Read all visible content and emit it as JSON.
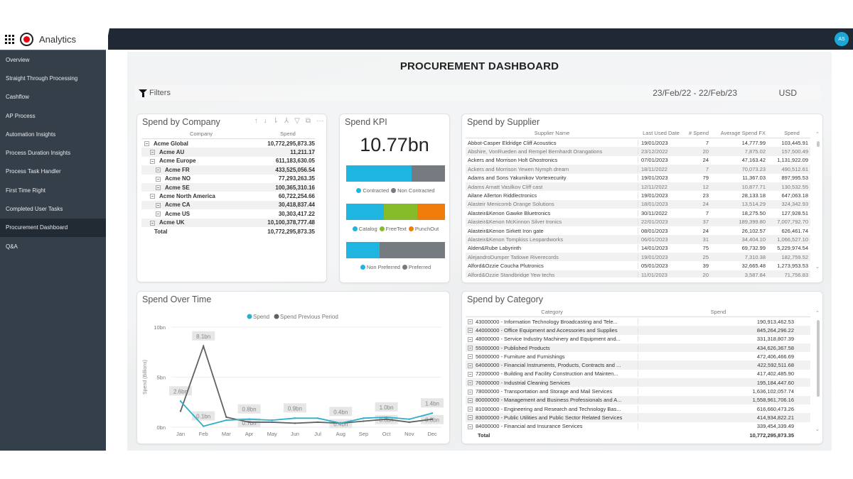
{
  "app": {
    "title": "Analytics",
    "user_initials": "AS",
    "accent_color": "#1aa6d9"
  },
  "sidebar": {
    "items": [
      {
        "label": "Overview",
        "active": false
      },
      {
        "label": "Straight Through Processing",
        "active": false
      },
      {
        "label": "Cashflow",
        "active": false
      },
      {
        "label": "AP Process",
        "active": false
      },
      {
        "label": "Automation Insights",
        "active": false
      },
      {
        "label": "Process Duration Insights",
        "active": false
      },
      {
        "label": "Process Task Handler",
        "active": false
      },
      {
        "label": "First Time Right",
        "active": false
      },
      {
        "label": "Completed User Tasks",
        "active": false
      },
      {
        "label": "Procurement Dashboard",
        "active": true
      },
      {
        "label": "Q&A",
        "active": false
      }
    ]
  },
  "report": {
    "title": "PROCUREMENT DASHBOARD",
    "filters_label": "Filters",
    "date_range": "23/Feb/22 - 22/Feb/23",
    "currency": "USD"
  },
  "spend_by_company": {
    "title": "Spend by Company",
    "columns": [
      "Company",
      "Spend"
    ],
    "header_icons": [
      "sort-ascending-icon",
      "sort-descending-icon",
      "expand-all-icon",
      "drill-hierarchy-icon",
      "filter-icon",
      "focus-mode-icon",
      "more-options-icon"
    ],
    "rows": [
      {
        "name": "Acme Global",
        "level": 0,
        "spend": "10,772,295,873.35"
      },
      {
        "name": "Acme AU",
        "level": 1,
        "spend": "11,211.17"
      },
      {
        "name": "Acme Europe",
        "level": 1,
        "spend": "611,183,630.05"
      },
      {
        "name": "Acme FR",
        "level": 2,
        "spend": "433,525,056.54"
      },
      {
        "name": "Acme NO",
        "level": 2,
        "spend": "77,293,263.35"
      },
      {
        "name": "Acme SE",
        "level": 2,
        "spend": "100,365,310.16"
      },
      {
        "name": "Acme North America",
        "level": 1,
        "spend": "60,722,254.66"
      },
      {
        "name": "Acme CA",
        "level": 2,
        "spend": "30,418,837.44"
      },
      {
        "name": "Acme US",
        "level": 2,
        "spend": "30,303,417.22"
      },
      {
        "name": "Acme UK",
        "level": 1,
        "spend": "10,100,378,777.48"
      }
    ],
    "total_label": "Total",
    "total": "10,772,295,873.35"
  },
  "spend_kpi": {
    "title": "Spend KPI",
    "value": "10.77bn",
    "bars": [
      {
        "segments": [
          {
            "label": "Contracted",
            "share": 0.66,
            "color": "#1eb6e0"
          },
          {
            "label": "Non Contracted",
            "share": 0.34,
            "color": "#767b82"
          }
        ]
      },
      {
        "segments": [
          {
            "label": "Catalog",
            "share": 0.38,
            "color": "#1eb6e0"
          },
          {
            "label": "FreeText",
            "share": 0.34,
            "color": "#86bb2a"
          },
          {
            "label": "PunchOut",
            "share": 0.28,
            "color": "#f07d0b"
          }
        ]
      },
      {
        "segments": [
          {
            "label": "Non Preferred",
            "share": 0.34,
            "color": "#1eb6e0"
          },
          {
            "label": "Preferred",
            "share": 0.66,
            "color": "#767b82"
          }
        ]
      }
    ]
  },
  "spend_by_supplier": {
    "title": "Spend by Supplier",
    "columns": [
      "Supplier Name",
      "Last Used Date",
      "# Spend",
      "Average Spend FX",
      "Spend"
    ],
    "rows": [
      [
        "Abbot-Casper Eldridge Cliff Acoustics",
        "19/01/2023",
        "7",
        "14,777.99",
        "103,445.91"
      ],
      [
        "Abshire, VonRueden and Rempel Bernhardt Orangations",
        "23/12/2022",
        "20",
        "7,875.02",
        "157,500.49"
      ],
      [
        "Ackers and Morrison Holt Ghostronics",
        "07/01/2023",
        "24",
        "47,163.42",
        "1,131,922.09"
      ],
      [
        "Ackers and Morrison Yewen Nymph dream",
        "18/11/2022",
        "7",
        "70,073.23",
        "490,512.61"
      ],
      [
        "Adams and Sons Yakunikov Vortexecurity",
        "19/01/2023",
        "79",
        "11,367.03",
        "897,995.53"
      ],
      [
        "Adams Arnatt Vasilkov Cliff cast",
        "12/11/2022",
        "12",
        "10,877.71",
        "130,532.55"
      ],
      [
        "Ailane Allerton Riddlectronics",
        "19/01/2023",
        "23",
        "28,133.18",
        "647,063.18"
      ],
      [
        "Alasteir Menicomb Orange Solutions",
        "18/01/2023",
        "24",
        "13,514.29",
        "324,342.93"
      ],
      [
        "Alasteir&Kenon Gawke Bluetronics",
        "30/11/2022",
        "7",
        "18,275.50",
        "127,928.51"
      ],
      [
        "Alasteir&Kenon McKinnon Silver tronics",
        "22/01/2023",
        "37",
        "189,399.80",
        "7,007,792.70"
      ],
      [
        "Alasteir&Kenon Sirkett Iron gate",
        "08/01/2023",
        "24",
        "26,102.57",
        "626,461.74"
      ],
      [
        "Alasteir&Kenon Tompkiss Leopardworks",
        "06/01/2023",
        "31",
        "34,404.10",
        "1,066,527.10"
      ],
      [
        "Alden&Rube Labyrinth",
        "14/01/2023",
        "75",
        "69,732.99",
        "5,229,974.54"
      ],
      [
        "AlejandroDumper Tatlowe Riverecords",
        "19/01/2023",
        "25",
        "7,310.38",
        "182,759.52"
      ],
      [
        "Alford&Ozzie Coucha Plutronics",
        "05/01/2023",
        "39",
        "32,665.48",
        "1,273,953.53"
      ],
      [
        "Alford&Ozzie Standbridge Yew techs",
        "11/01/2023",
        "20",
        "3,587.84",
        "71,756.83"
      ]
    ]
  },
  "spend_over_time": {
    "title": "Spend Over Time"
  },
  "chart_data": {
    "type": "line",
    "title": "Spend Over Time",
    "xlabel": "",
    "ylabel": "Spend (Billions)",
    "ylim": [
      0,
      10
    ],
    "yticks": [
      "0bn",
      "5bn",
      "10bn"
    ],
    "ytick_values": [
      0,
      5,
      10
    ],
    "grid": true,
    "legend": "top-center",
    "categories": [
      "Jan",
      "Feb",
      "Mar",
      "Apr",
      "May",
      "Jun",
      "Jul",
      "Aug",
      "Sep",
      "Oct",
      "Nov",
      "Dec"
    ],
    "series": [
      {
        "name": "Spend",
        "color": "#2ab0c9",
        "values": [
          2.6,
          0.1,
          0.7,
          0.8,
          0.7,
          0.9,
          0.9,
          0.4,
          0.9,
          1.0,
          0.8,
          1.4
        ]
      },
      {
        "name": "Spend Previous Period",
        "color": "#5f6166",
        "values": [
          1.6,
          8.1,
          1.0,
          0.5,
          0.5,
          0.4,
          0.5,
          0.4,
          0.6,
          0.8,
          0.5,
          0.8
        ]
      }
    ],
    "data_labels": [
      {
        "series": 0,
        "index": 0,
        "text": "2.6bn"
      },
      {
        "series": 1,
        "index": 1,
        "text": "8.1bn"
      },
      {
        "series": 0,
        "index": 1,
        "text": "0.1bn"
      },
      {
        "series": 0,
        "index": 3,
        "text": "0.8bn"
      },
      {
        "series": 1,
        "index": 3,
        "text": "0.7bn"
      },
      {
        "series": 0,
        "index": 5,
        "text": "0.9bn"
      },
      {
        "series": 0,
        "index": 7,
        "text": "0.4bn"
      },
      {
        "series": 1,
        "index": 7,
        "text": "0.4bn"
      },
      {
        "series": 0,
        "index": 9,
        "text": "1.0bn"
      },
      {
        "series": 1,
        "index": 9,
        "text": "0.8bn"
      },
      {
        "series": 0,
        "index": 11,
        "text": "1.4bn"
      },
      {
        "series": 1,
        "index": 11,
        "text": "0.8bn"
      }
    ]
  },
  "spend_by_category": {
    "title": "Spend by Category",
    "columns": [
      "Category",
      "Spend"
    ],
    "rows": [
      [
        "43000000 - Information Technology Broadcasting and Tele...",
        "190,913,462.53"
      ],
      [
        "44000000 - Office Equipment and Accessories and Supplies",
        "845,264,296.22"
      ],
      [
        "48000000 - Service Industry Machinery and Equipment and...",
        "331,318,807.39"
      ],
      [
        "55000000 - Published Products",
        "434,626,367.58"
      ],
      [
        "56000000 - Furniture and Furnishings",
        "472,406,466.69"
      ],
      [
        "64000000 - Financial Instruments, Products, Contracts and ...",
        "422,592,511.68"
      ],
      [
        "72000000 - Building and Facility Construction and Mainten...",
        "417,402,485.90"
      ],
      [
        "76000000 - Industrial Cleaning Services",
        "195,184,447.60"
      ],
      [
        "78000000 - Transportation and Storage and Mail Services",
        "1,636,102,057.74"
      ],
      [
        "80000000 - Management and Business Professionals and A...",
        "1,558,961,706.16"
      ],
      [
        "81000000 - Engineering and Research and Technology Bas...",
        "616,660,473.26"
      ],
      [
        "83000000 - Public Utilities and Public Sector Related Services",
        "414,934,822.21"
      ],
      [
        "84000000 - Financial and Insurance Services",
        "339,454,339.49"
      ]
    ],
    "total_label": "Total",
    "total": "10,772,295,873.35"
  }
}
